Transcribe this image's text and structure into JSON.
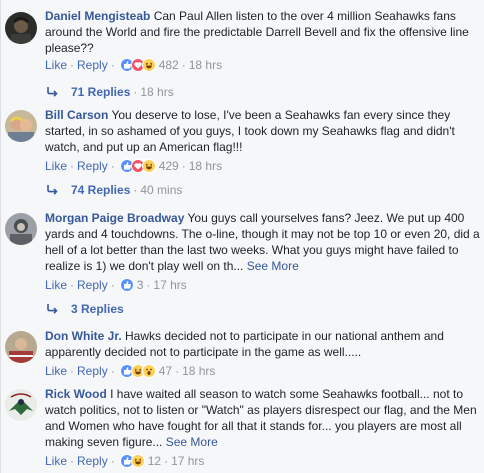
{
  "comments": [
    {
      "author": "Daniel Mengisteab",
      "text": "Can Paul Allen listen to the over 4 million Seahawks fans around the World and fire the predictable Darrell Bevell and fix the offensive line please??",
      "see_more": "",
      "like_label": "Like",
      "reply_label": "Reply",
      "reactions": [
        "like",
        "love",
        "haha"
      ],
      "reaction_count": "482",
      "time": "18 hrs",
      "replies": {
        "label": "71 Replies",
        "time": "18 hrs"
      }
    },
    {
      "author": "Bill Carson",
      "text": "You deserve to lose, I've been a Seahawks fan every since they started, in so ashamed of you guys, I took down my Seahawks flag and didn't watch, and put up an American flag!!!",
      "see_more": "",
      "like_label": "Like",
      "reply_label": "Reply",
      "reactions": [
        "like",
        "love",
        "haha"
      ],
      "reaction_count": "429",
      "time": "18 hrs",
      "replies": {
        "label": "74 Replies",
        "time": "40 mins"
      }
    },
    {
      "author": "Morgan Paige Broadway",
      "text": "You guys call yourselves fans? Jeez. We put up 400 yards and 4 touchdowns. The o-line, though it may not be top 10 or even 20, did a hell of a lot better than the last two weeks. What you guys might have failed to realize is 1) we don't play well on th...",
      "see_more": "See More",
      "like_label": "Like",
      "reply_label": "Reply",
      "reactions": [
        "like"
      ],
      "reaction_count": "3",
      "time": "17 hrs",
      "replies": {
        "label": "3 Replies",
        "time": ""
      }
    },
    {
      "author": "Don White Jr.",
      "text": "Hawks decided not to participate in our national anthem and apparently decided not to participate in the game as well.....",
      "see_more": "",
      "like_label": "Like",
      "reply_label": "Reply",
      "reactions": [
        "like",
        "haha",
        "wow"
      ],
      "reaction_count": "47",
      "time": "18 hrs",
      "replies": null
    },
    {
      "author": "Rick Wood",
      "text": "I have waited all season to watch some Seahawks football... not to watch politics, not to listen or \"Watch\" as players disrespect our flag, and the Men and Women who have fought for all that it stands for... you players are most all making seven figure...",
      "see_more": "See More",
      "like_label": "Like",
      "reply_label": "Reply",
      "reactions": [
        "like",
        "haha"
      ],
      "reaction_count": "12",
      "time": "17 hrs",
      "replies": null
    }
  ],
  "colors": {
    "author_link": "#365899",
    "action_link": "#4267b2",
    "meta": "#90949c",
    "like": "#5890ff",
    "love": "#f25268",
    "haha": "#fcd15b"
  },
  "separator": "·"
}
